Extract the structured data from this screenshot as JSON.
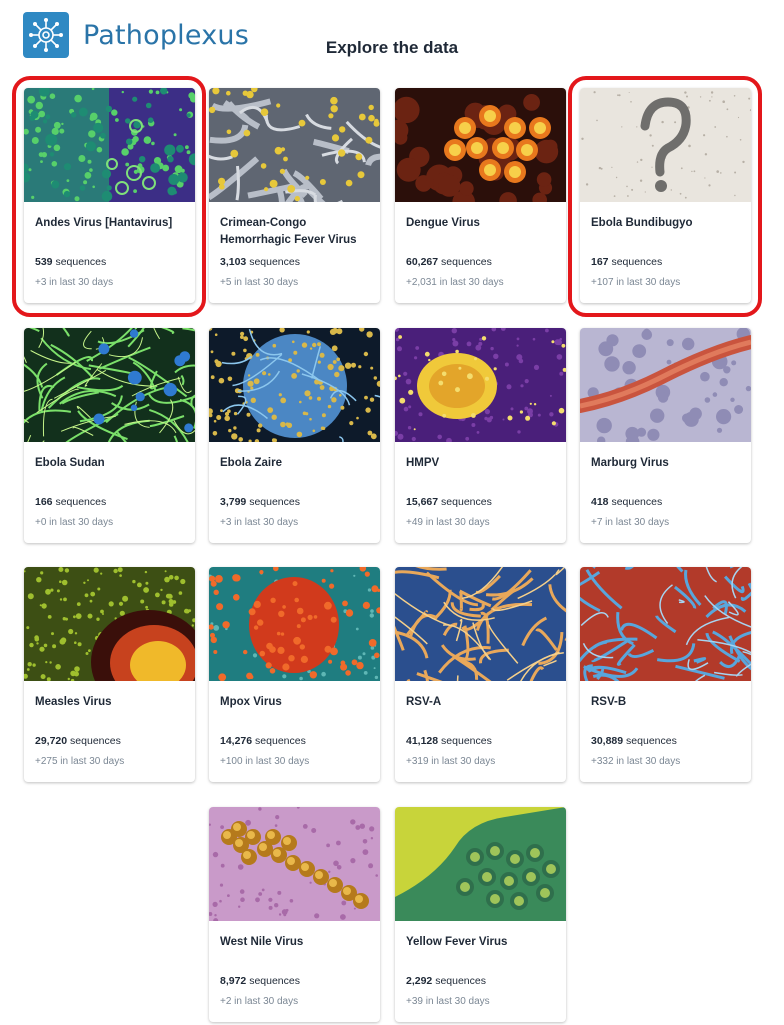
{
  "header": {
    "logo_text": "Pathoplexus",
    "title": "Explore the data",
    "brand_color": "#2f89c3"
  },
  "cards": [
    {
      "name": "Andes Virus [Hantavirus]",
      "count": "539",
      "unit": "sequences",
      "recent": "+3 in last 30 days",
      "image": "green-cells-micrograph"
    },
    {
      "name": "Crimean-Congo Hemorrhagic Fever Virus",
      "count": "3,103",
      "unit": "sequences",
      "recent": "+5 in last 30 days",
      "image": "yellow-particles-micrograph"
    },
    {
      "name": "Dengue Virus",
      "count": "60,267",
      "unit": "sequences",
      "recent": "+2,031 in last 30 days",
      "image": "orange-virions-micrograph"
    },
    {
      "name": "Ebola Bundibugyo",
      "count": "167",
      "unit": "sequences",
      "recent": "+107 in last 30 days",
      "image": "question-mark-sketch"
    },
    {
      "name": "Ebola Sudan",
      "count": "166",
      "unit": "sequences",
      "recent": "+0 in last 30 days",
      "image": "green-filaments-micrograph"
    },
    {
      "name": "Ebola Zaire",
      "count": "3,799",
      "unit": "sequences",
      "recent": "+3 in last 30 days",
      "image": "blue-cell-micrograph"
    },
    {
      "name": "HMPV",
      "count": "15,667",
      "unit": "sequences",
      "recent": "+49 in last 30 days",
      "image": "purple-yellow-micrograph"
    },
    {
      "name": "Marburg Virus",
      "count": "418",
      "unit": "sequences",
      "recent": "+7 in last 30 days",
      "image": "red-filament-micrograph"
    },
    {
      "name": "Measles Virus",
      "count": "29,720",
      "unit": "sequences",
      "recent": "+275 in last 30 days",
      "image": "measles-micrograph"
    },
    {
      "name": "Mpox Virus",
      "count": "14,276",
      "unit": "sequences",
      "recent": "+100 in last 30 days",
      "image": "teal-red-micrograph"
    },
    {
      "name": "RSV-A",
      "count": "41,128",
      "unit": "sequences",
      "recent": "+319 in last 30 days",
      "image": "blue-orange-filaments"
    },
    {
      "name": "RSV-B",
      "count": "30,889",
      "unit": "sequences",
      "recent": "+332 in last 30 days",
      "image": "red-blue-filaments"
    },
    {
      "name": "West Nile Virus",
      "count": "8,972",
      "unit": "sequences",
      "recent": "+2 in last 30 days",
      "image": "gold-clusters-micrograph"
    },
    {
      "name": "Yellow Fever Virus",
      "count": "2,292",
      "unit": "sequences",
      "recent": "+39 in last 30 days",
      "image": "yellow-green-micrograph"
    }
  ],
  "annotations": {
    "highlight_color": "#e3171b",
    "highlighted_cards": [
      "Andes Virus [Hantavirus]",
      "Ebola Bundibugyo"
    ]
  }
}
